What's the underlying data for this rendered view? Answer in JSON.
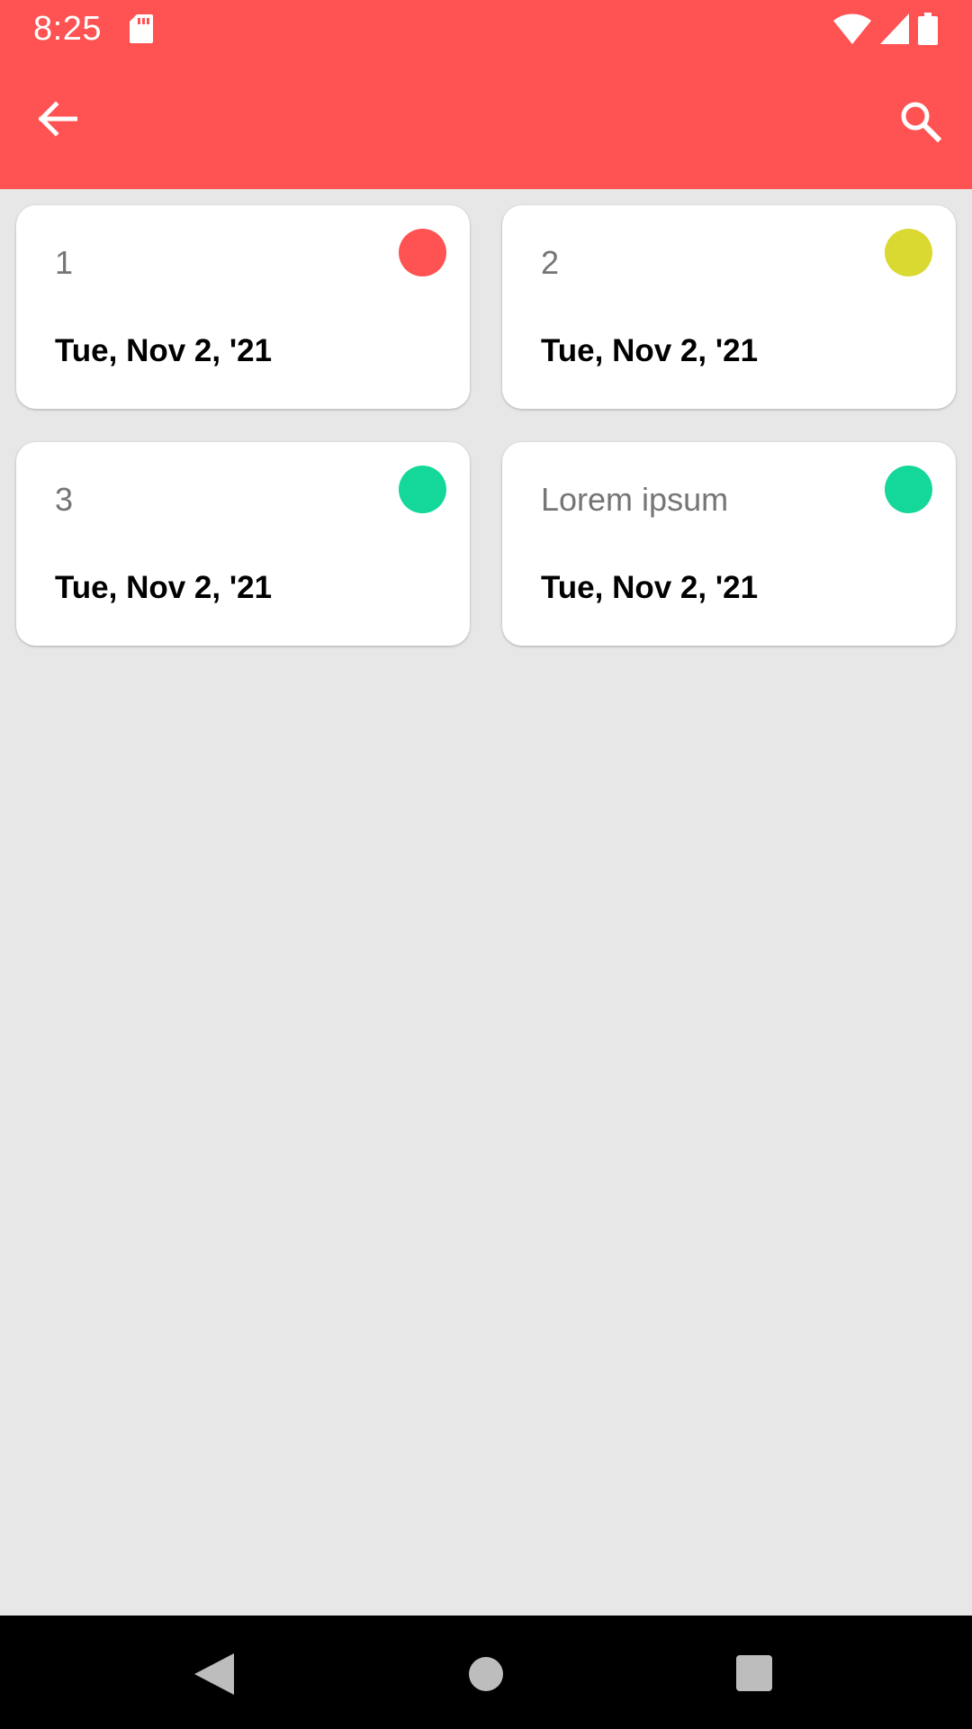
{
  "status_bar": {
    "time": "8:25",
    "icons": [
      "sd-card-icon",
      "wifi-icon",
      "cell-signal-icon",
      "battery-icon"
    ]
  },
  "app_bar": {
    "background_color": "#ff5252",
    "back_icon": "back-arrow-icon",
    "search_icon": "search-icon"
  },
  "notes": [
    {
      "title": "1",
      "date": "Tue, Nov 2, '21",
      "color": "#ff5252"
    },
    {
      "title": "2",
      "date": "Tue, Nov 2, '21",
      "color": "#d9d931"
    },
    {
      "title": "3",
      "date": "Tue, Nov 2, '21",
      "color": "#13d899"
    },
    {
      "title": "Lorem ipsum",
      "date": "Tue, Nov 2, '21",
      "color": "#13d899"
    }
  ],
  "nav_bar": {
    "icons": [
      "nav-back-icon",
      "nav-home-icon",
      "nav-recents-icon"
    ]
  }
}
